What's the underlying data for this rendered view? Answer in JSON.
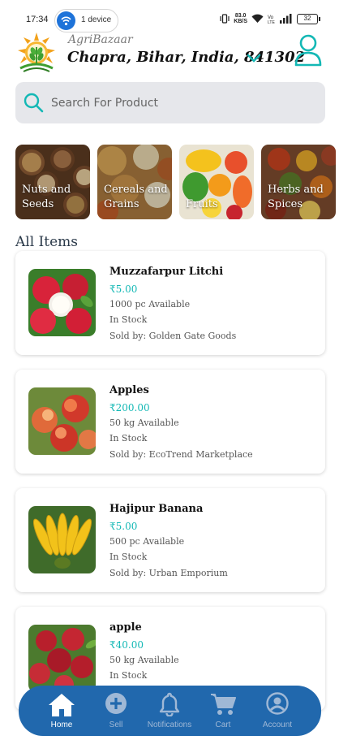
{
  "status_bar": {
    "time": "17:34",
    "hotspot_label": "1 device",
    "speed_top": "83.0",
    "speed_unit": "KB/S",
    "battery": "32"
  },
  "header": {
    "brand": "AgriBazaar",
    "location": "Chapra, Bihar, India, 841302"
  },
  "search": {
    "placeholder": "Search For Product"
  },
  "categories": [
    {
      "label_line1": "Nuts and",
      "label_line2": "Seeds"
    },
    {
      "label_line1": "Cereals and",
      "label_line2": "Grains"
    },
    {
      "label_line1": "Fruits",
      "label_line2": ""
    },
    {
      "label_line1": "Herbs and",
      "label_line2": "Spices"
    }
  ],
  "section_title": "All Items",
  "products": [
    {
      "name": "Muzzafarpur Litchi",
      "price": "₹5.00",
      "availability": "1000 pc Available",
      "stock": "In Stock",
      "seller": "Sold by: Golden Gate Goods"
    },
    {
      "name": "Apples",
      "price": "₹200.00",
      "availability": "50 kg Available",
      "stock": "In Stock",
      "seller": "Sold by: EcoTrend Marketplace"
    },
    {
      "name": "Hajipur Banana",
      "price": "₹5.00",
      "availability": "500 pc Available",
      "stock": "In Stock",
      "seller": "Sold by: Urban Emporium"
    },
    {
      "name": "apple",
      "price": "₹40.00",
      "availability": "50 kg Available",
      "stock": "In Stock",
      "seller": ""
    }
  ],
  "bottom_nav": [
    {
      "label": "Home",
      "icon": "home-icon",
      "active": true
    },
    {
      "label": "Sell",
      "icon": "plus-circle-icon",
      "active": false
    },
    {
      "label": "Notifications",
      "icon": "bell-icon",
      "active": false
    },
    {
      "label": "Cart",
      "icon": "cart-icon",
      "active": false
    },
    {
      "label": "Account",
      "icon": "account-circle-icon",
      "active": false
    }
  ],
  "colors": {
    "accent": "#13b8b5",
    "nav_bg": "#2168ad",
    "search_bg": "#e6e7eb"
  }
}
